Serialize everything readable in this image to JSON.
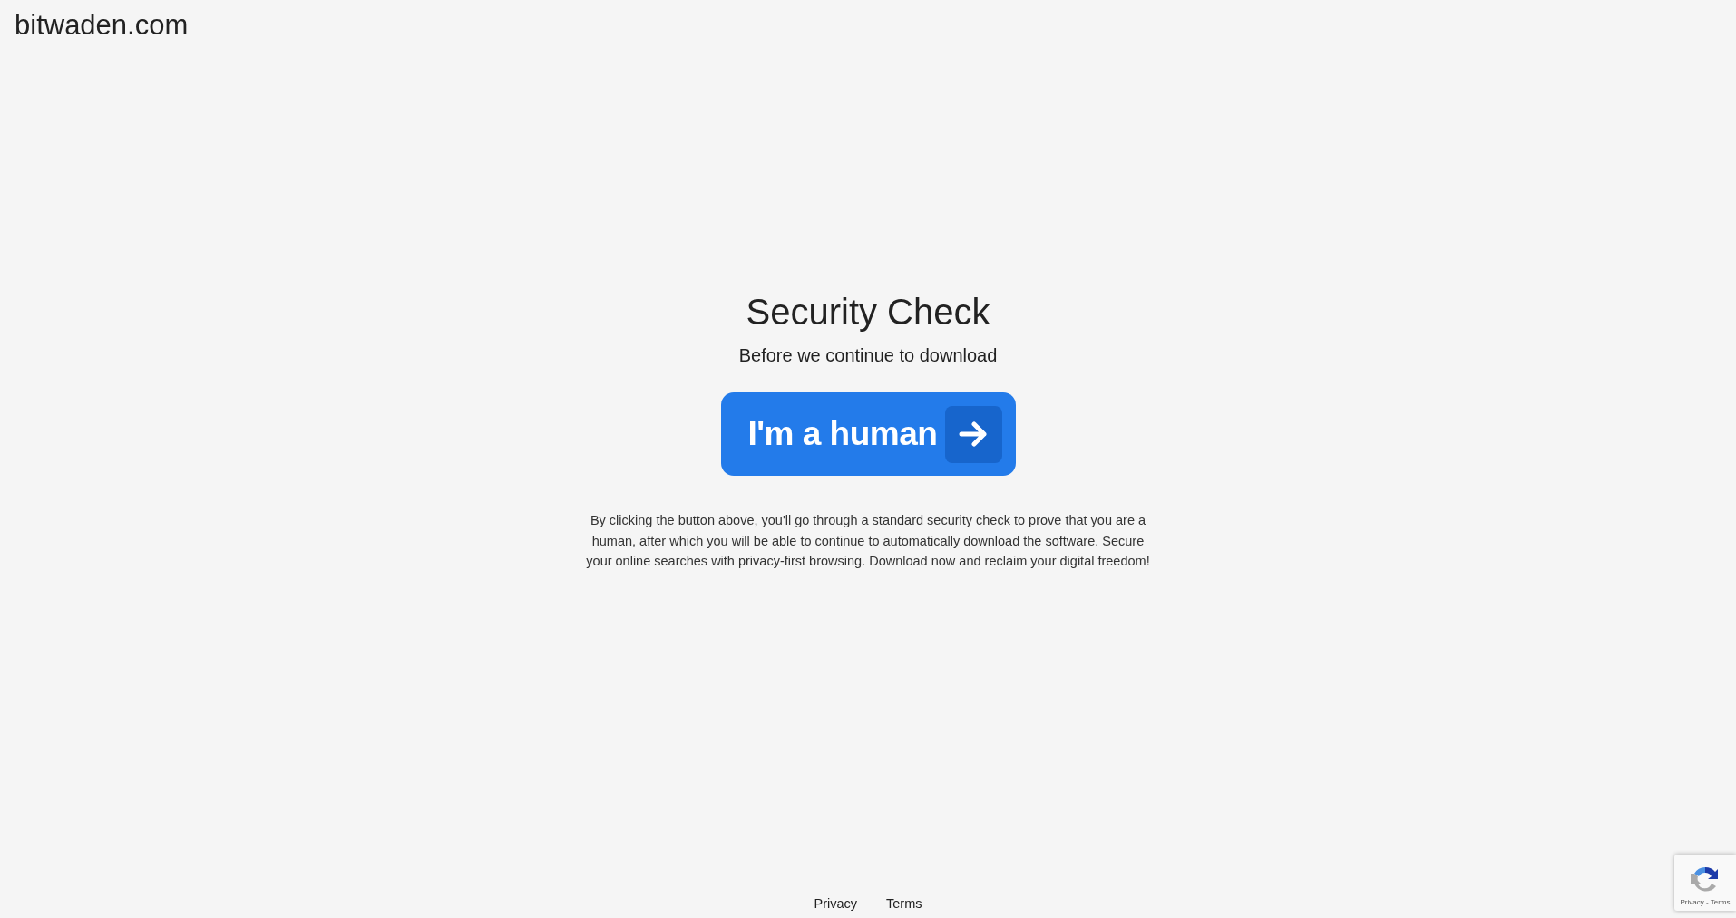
{
  "site_title": "bitwaden.com",
  "heading": "Security Check",
  "subtitle": "Before we continue to download",
  "button": {
    "label": "I'm a human"
  },
  "description": "By clicking the button above, you'll go through a standard security check to prove that you are a human, after which you will be able to continue to automatically download the software. Secure your online searches with privacy-first browsing. Download now and reclaim your digital freedom!",
  "footer_links": [
    "Privacy",
    "Terms"
  ],
  "recaptcha_badge": {
    "links": "Privacy - Terms"
  }
}
